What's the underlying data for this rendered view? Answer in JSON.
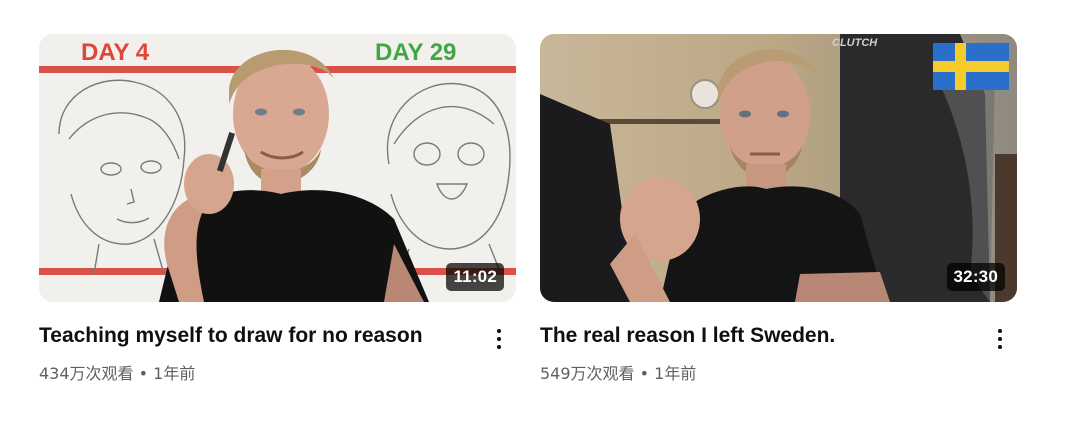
{
  "videos": [
    {
      "title": "Teaching myself to draw for no reason",
      "stats": "434万次观看 • 1年前",
      "duration": "11:02",
      "thumb_text_left": "DAY 4",
      "thumb_text_right": "DAY 29",
      "colors": {
        "left_label": "#e0453a",
        "right_label": "#3fa845",
        "stripe": "#d9524a"
      }
    },
    {
      "title": "The real reason I left Sweden.",
      "stats": "549万次观看 • 1年前",
      "duration": "32:30",
      "chair_brand": "CLUTCH",
      "flag_icon": "sweden-flag-icon",
      "colors": {
        "flag_blue": "#2a6fc9",
        "flag_yellow": "#f5cb2a"
      }
    }
  ]
}
